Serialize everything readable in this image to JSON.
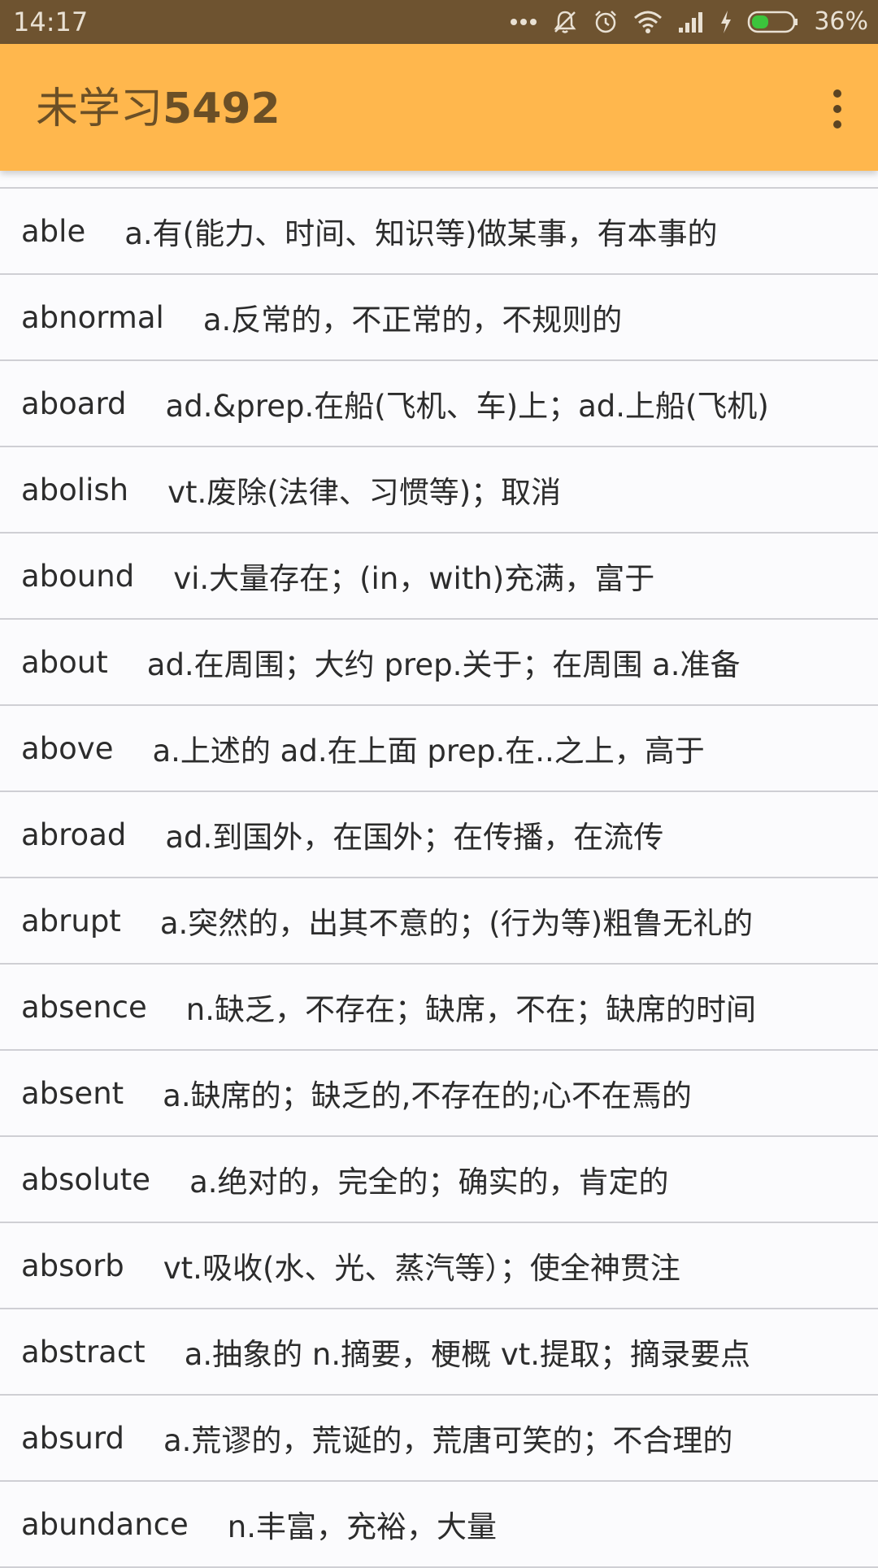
{
  "status_bar": {
    "time": "14:17",
    "battery_percent": "36%",
    "icons": [
      "more-dots-icon",
      "mute-icon",
      "alarm-icon",
      "wifi-icon",
      "signal-icon",
      "charging-icon",
      "battery-icon"
    ]
  },
  "app_bar": {
    "title_prefix": "未学习",
    "title_count": "5492",
    "overflow_icon": "more-vert-icon"
  },
  "colors": {
    "status_bar_bg": "#6e5330",
    "app_bar_bg": "#ffb74d",
    "title_color": "#6b4f26",
    "divider": "#cfcfd4"
  },
  "words": [
    {
      "word": "able",
      "meaning": "a.有(能力、时间、知识等)做某事，有本事的"
    },
    {
      "word": "abnormal",
      "meaning": "a.反常的，不正常的，不规则的"
    },
    {
      "word": "aboard",
      "meaning": "ad.&prep.在船(飞机、车)上；ad.上船(飞机)"
    },
    {
      "word": "abolish",
      "meaning": "vt.废除(法律、习惯等)；取消"
    },
    {
      "word": "abound",
      "meaning": "vi.大量存在；(in，with)充满，富于"
    },
    {
      "word": "about",
      "meaning": "ad.在周围；大约 prep.关于；在周围 a.准备"
    },
    {
      "word": "above",
      "meaning": "a.上述的 ad.在上面  prep.在..之上，高于"
    },
    {
      "word": "abroad",
      "meaning": "ad.到国外，在国外；在传播，在流传"
    },
    {
      "word": "abrupt",
      "meaning": "a.突然的，出其不意的；(行为等)粗鲁无礼的"
    },
    {
      "word": "absence",
      "meaning": "n.缺乏，不存在；缺席，不在；缺席的时间"
    },
    {
      "word": "absent",
      "meaning": "a.缺席的；缺乏的,不存在的;心不在焉的"
    },
    {
      "word": "absolute",
      "meaning": "a.绝对的，完全的；确实的，肯定的"
    },
    {
      "word": "absorb",
      "meaning": "vt.吸收(水、光、蒸汽等）；使全神贯注"
    },
    {
      "word": "abstract",
      "meaning": "a.抽象的 n.摘要，梗概 vt.提取；摘录要点"
    },
    {
      "word": "absurd",
      "meaning": "a.荒谬的，荒诞的，荒唐可笑的；不合理的"
    },
    {
      "word": "abundance",
      "meaning": "n.丰富，充裕，大量"
    }
  ]
}
